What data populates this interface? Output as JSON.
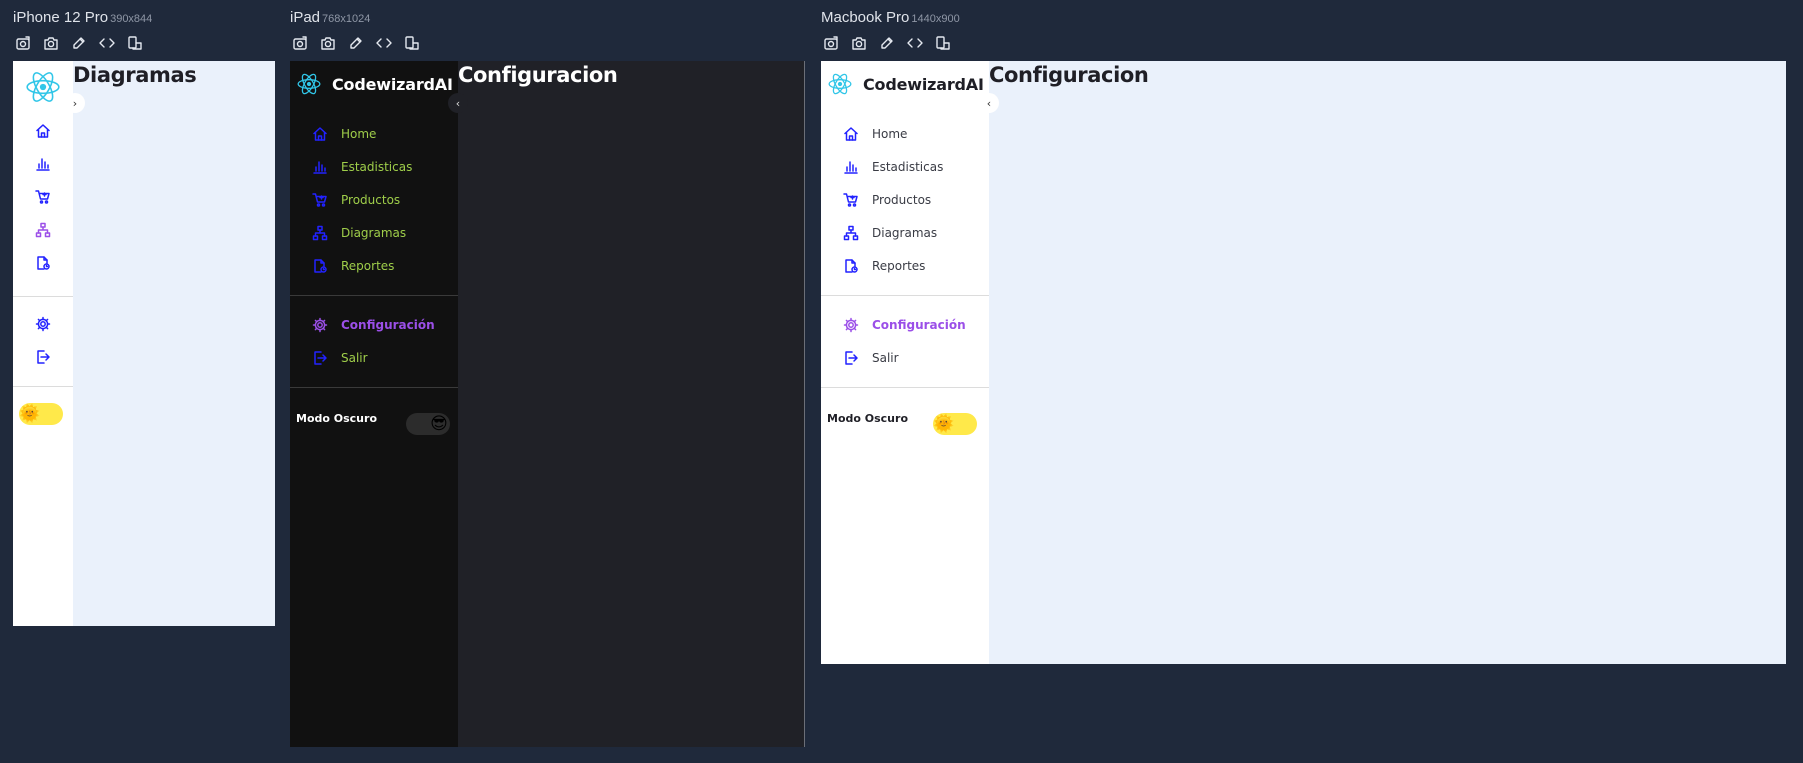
{
  "devices": [
    {
      "name": "iPhone 12 Pro",
      "size": "390x844",
      "theme": "light",
      "sidebar_state": "collapsed",
      "toggle_glyph": "›",
      "page_title": "Diagramas",
      "mode_label": "",
      "toggle_state": "off",
      "toggle_icon": "sun-icon"
    },
    {
      "name": "iPad",
      "size": "768x1024",
      "theme": "dark",
      "sidebar_state": "expanded",
      "toggle_glyph": "‹",
      "page_title": "Configuracion",
      "mode_label": "Modo Oscuro",
      "toggle_state": "on",
      "toggle_icon": "sunglasses-face-icon"
    },
    {
      "name": "Macbook Pro",
      "size": "1440x900",
      "theme": "light",
      "sidebar_state": "expanded",
      "toggle_glyph": "‹",
      "page_title": "Configuracion",
      "mode_label": "Modo Oscuro",
      "toggle_state": "off",
      "toggle_icon": "sun-icon"
    }
  ],
  "toolbar_icons": [
    "rotate-camera-icon",
    "screenshot-camera-icon",
    "eyedropper-icon",
    "code-icon",
    "device-swap-icon"
  ],
  "brand": "CodewizardAI",
  "nav": [
    {
      "label": "Home",
      "icon": "home-icon"
    },
    {
      "label": "Estadisticas",
      "icon": "bar-chart-icon"
    },
    {
      "label": "Productos",
      "icon": "cart-icon"
    },
    {
      "label": "Diagramas",
      "icon": "sitemap-icon"
    },
    {
      "label": "Reportes",
      "icon": "report-file-icon"
    }
  ],
  "secondary_nav": [
    {
      "label": "Configuración",
      "icon": "gear-icon"
    },
    {
      "label": "Salir",
      "icon": "logout-icon"
    }
  ],
  "colors": {
    "canvas": "#1f293b",
    "content_light": "#eaf1fb",
    "content_dark": "#202127",
    "sidebar_dark": "#111111",
    "nav_icon": "#2222ff",
    "accent": "#9b4fe8",
    "dark_nav_label": "#9fce4a",
    "toggle_on_light": "#ffe94a"
  }
}
